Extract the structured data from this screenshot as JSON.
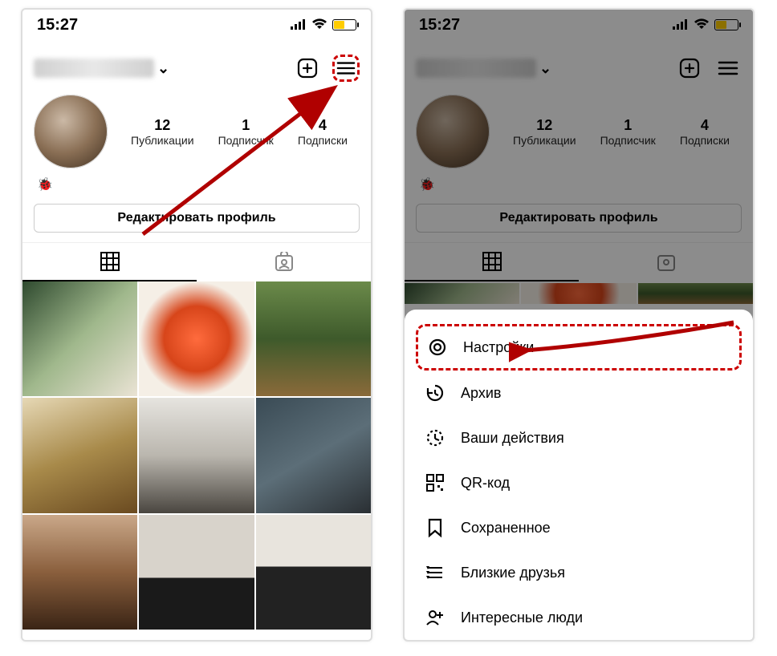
{
  "status": {
    "time": "15:27"
  },
  "profile": {
    "stats": [
      {
        "num": "12",
        "label": "Публикации"
      },
      {
        "num": "1",
        "label": "Подписчик"
      },
      {
        "num": "4",
        "label": "Подписки"
      }
    ],
    "edit_button": "Редактировать профиль"
  },
  "menu": {
    "settings": "Настройки",
    "archive": "Архив",
    "activity": "Ваши действия",
    "qr": "QR-код",
    "saved": "Сохраненное",
    "close_friends": "Близкие друзья",
    "discover_people": "Интересные люди"
  }
}
